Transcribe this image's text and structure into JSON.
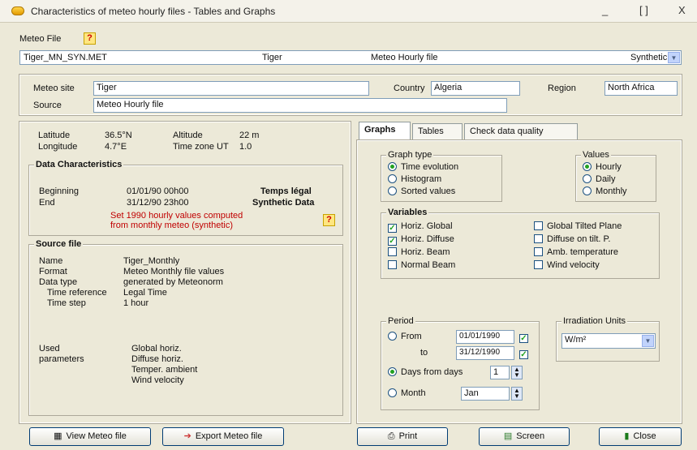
{
  "window": {
    "title": "Characteristics of meteo hourly files - Tables and Graphs",
    "controls": [
      "_",
      "[ ]",
      "X"
    ]
  },
  "meteo_file": {
    "label": "Meteo File",
    "file_name": "Tiger_MN_SYN.MET",
    "site": "Tiger",
    "type": "Meteo Hourly file",
    "dropdown_value": "Synthetic"
  },
  "site_info": {
    "meteo_site_label": "Meteo site",
    "meteo_site_value": "Tiger",
    "country_label": "Country",
    "country_value": "Algeria",
    "region_label": "Region",
    "region_value": "North Africa",
    "source_label": "Source",
    "source_value": "Meteo Hourly file"
  },
  "geo": {
    "latitude_label": "Latitude",
    "latitude_value": "36.5°N",
    "longitude_label": "Longitude",
    "longitude_value": "4.7°E",
    "altitude_label": "Altitude",
    "altitude_value": "22 m",
    "timezone_label": "Time zone UT",
    "timezone_value": "1.0"
  },
  "data_char": {
    "title": "Data Characteristics",
    "beginning_label": "Beginning",
    "beginning_value": "01/01/90 00h00",
    "beginning_mode": "Temps légal",
    "end_label": "End",
    "end_value": "31/12/90 23h00",
    "end_mode": "Synthetic Data",
    "note_line1": "Set 1990 hourly values computed",
    "note_line2": "from monthly meteo (synthetic)"
  },
  "source_file": {
    "title": "Source file",
    "name_label": "Name",
    "name_value": "Tiger_Monthly",
    "format_label": "Format",
    "format_value": "Meteo Monthly file values",
    "data_type_label": "Data type",
    "data_type_value": "generated by Meteonorm",
    "time_ref_label": "Time reference",
    "time_ref_value": "Legal Time",
    "time_step_label": "Time step",
    "time_step_value": "1 hour"
  },
  "used": {
    "label1": "Used",
    "label2": "parameters",
    "items": [
      "Global horiz.",
      "Diffuse horiz.",
      "Temper. ambient",
      "Wind velocity"
    ]
  },
  "tabs": [
    "Graphs",
    "Tables",
    "Check data quality"
  ],
  "graph_type": {
    "title": "Graph type",
    "options": [
      {
        "label": "Time evolution",
        "selected": true
      },
      {
        "label": "Histogram",
        "selected": false
      },
      {
        "label": "Sorted values",
        "selected": false
      }
    ]
  },
  "values": {
    "title": "Values",
    "options": [
      {
        "label": "Hourly",
        "selected": true
      },
      {
        "label": "Daily",
        "selected": false
      },
      {
        "label": "Monthly",
        "selected": false
      }
    ]
  },
  "variables": {
    "title": "Variables",
    "left": [
      {
        "label": "Horiz. Global",
        "checked": true
      },
      {
        "label": "Horiz. Diffuse",
        "checked": true
      },
      {
        "label": "Horiz. Beam",
        "checked": false
      },
      {
        "label": "Normal Beam",
        "checked": false
      }
    ],
    "right": [
      {
        "label": "Global Tilted Plane",
        "checked": false
      },
      {
        "label": "Diffuse on tilt. P.",
        "checked": false
      },
      {
        "label": "Amb. temperature",
        "checked": false
      },
      {
        "label": "Wind velocity",
        "checked": false
      }
    ]
  },
  "period": {
    "title": "Period",
    "from_label": "From",
    "from_value": "01/01/1990",
    "to_label": "to",
    "to_value": "31/12/1990",
    "days_label": "Days from days",
    "days_value": "1",
    "month_label": "Month",
    "month_value": "Jan"
  },
  "irradiation_units": {
    "title": "Irradiation Units",
    "value": "W/m²"
  },
  "buttons": {
    "view_meteo": "View Meteo file",
    "export_meteo": "Export Meteo file",
    "print": "Print",
    "screen": "Screen",
    "close": "Close"
  }
}
